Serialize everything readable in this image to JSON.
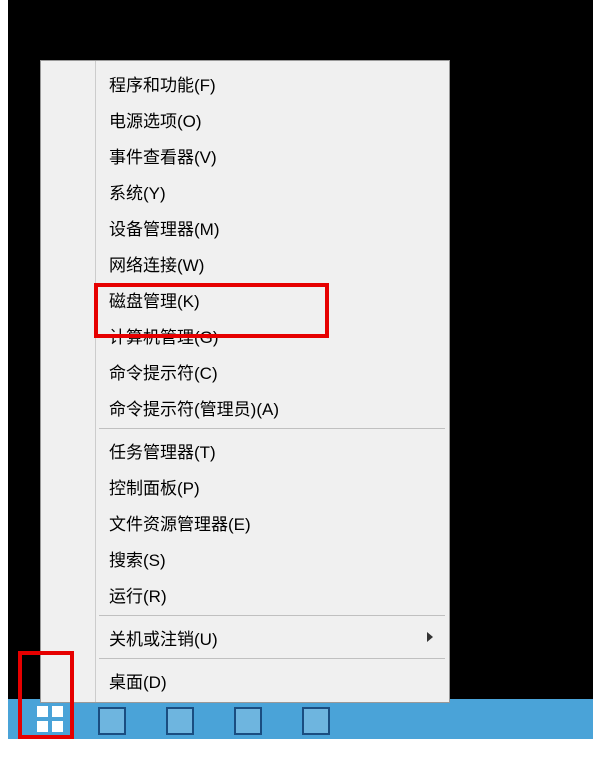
{
  "menu": {
    "group1": [
      {
        "label": "程序和功能(F)"
      },
      {
        "label": "电源选项(O)"
      },
      {
        "label": "事件查看器(V)"
      },
      {
        "label": "系统(Y)"
      },
      {
        "label": "设备管理器(M)"
      },
      {
        "label": "网络连接(W)"
      },
      {
        "label": "磁盘管理(K)"
      },
      {
        "label": "计算机管理(G)"
      },
      {
        "label": "命令提示符(C)"
      },
      {
        "label": "命令提示符(管理员)(A)"
      }
    ],
    "group2": [
      {
        "label": "任务管理器(T)"
      },
      {
        "label": "控制面板(P)"
      },
      {
        "label": "文件资源管理器(E)"
      },
      {
        "label": "搜索(S)"
      },
      {
        "label": "运行(R)"
      }
    ],
    "group3": [
      {
        "label": "关机或注销(U)",
        "has_submenu": true
      }
    ],
    "group4": [
      {
        "label": "桌面(D)"
      }
    ]
  }
}
